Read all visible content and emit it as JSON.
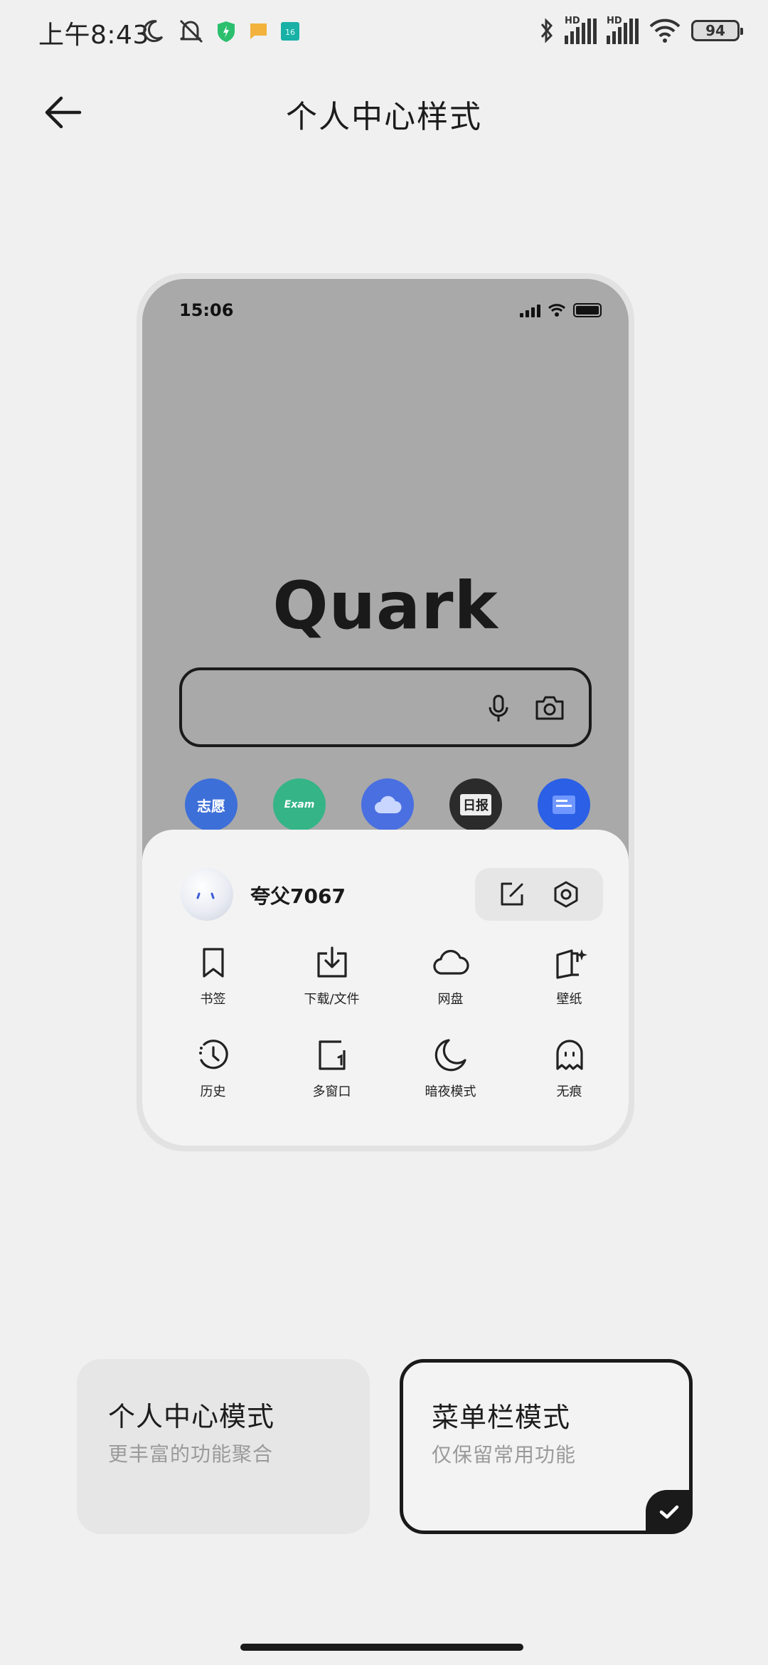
{
  "status_bar": {
    "time": "上午8:43",
    "hd1": "HD",
    "hd2": "HD",
    "battery": "94",
    "notif_badge": "16"
  },
  "header": {
    "title": "个人中心样式",
    "back_icon": "arrow-left-icon"
  },
  "preview": {
    "phone_time": "15:06",
    "logo": "Quark",
    "apps": [
      {
        "label": "志愿",
        "color": "#3d6fd8"
      },
      {
        "label": "Exam",
        "color": "#35b488"
      },
      {
        "label": "",
        "color": "#4a6fe0"
      },
      {
        "label": "日报",
        "color": "#2b2b2b"
      },
      {
        "label": "",
        "color": "#2a5fe6"
      }
    ],
    "user": {
      "name": "夸父7067"
    },
    "menu": [
      {
        "label": "书签",
        "icon": "bookmark-icon"
      },
      {
        "label": "下载/文件",
        "icon": "download-icon"
      },
      {
        "label": "网盘",
        "icon": "cloud-icon"
      },
      {
        "label": "壁纸",
        "icon": "wallpaper-icon"
      },
      {
        "label": "历史",
        "icon": "history-icon"
      },
      {
        "label": "多窗口",
        "icon": "multi-window-icon"
      },
      {
        "label": "暗夜模式",
        "icon": "moon-icon"
      },
      {
        "label": "无痕",
        "icon": "ghost-icon"
      }
    ]
  },
  "modes": [
    {
      "title": "个人中心模式",
      "subtitle": "更丰富的功能聚合",
      "selected": false
    },
    {
      "title": "菜单栏模式",
      "subtitle": "仅保留常用功能",
      "selected": true
    }
  ],
  "colors": {
    "background": "#f0f0f0",
    "preview_screen": "#a9a9a9",
    "selected_border": "#1a1a1a"
  }
}
